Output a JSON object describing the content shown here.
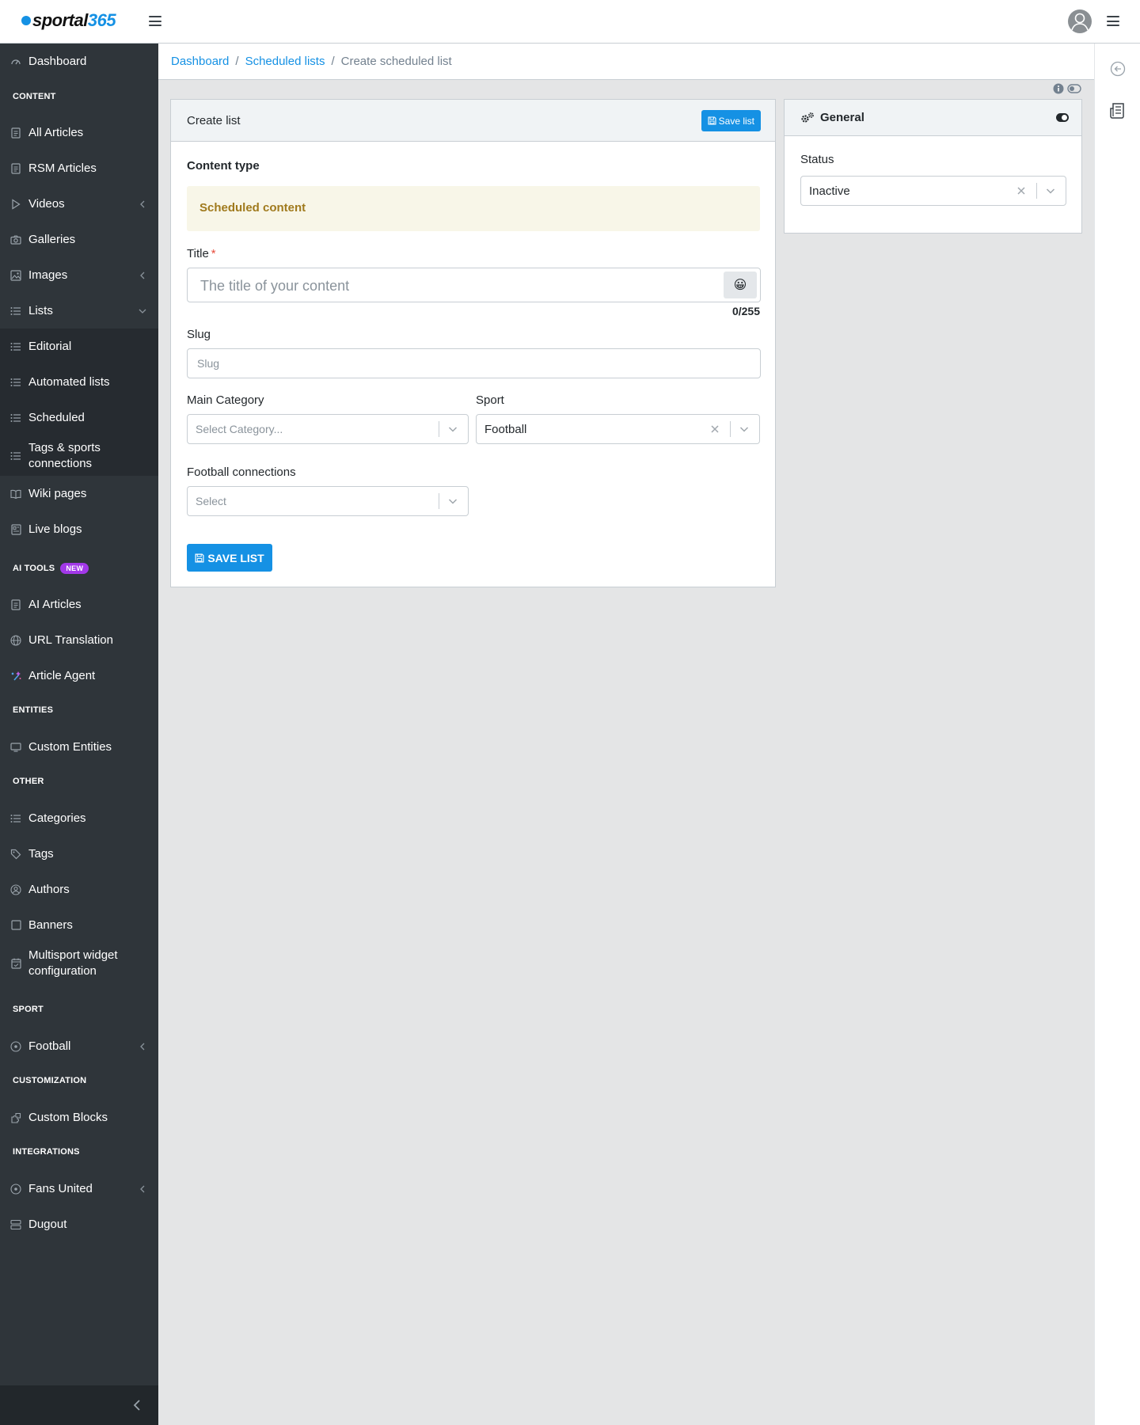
{
  "header": {
    "logo_text": "sportal",
    "logo_number": "365"
  },
  "sidebar": {
    "items": [
      {
        "label": "Dashboard"
      },
      {
        "label": "CONTENT"
      },
      {
        "label": "All Articles"
      },
      {
        "label": "RSM Articles"
      },
      {
        "label": "Videos"
      },
      {
        "label": "Galleries"
      },
      {
        "label": "Images"
      },
      {
        "label": "Lists"
      },
      {
        "label": "Editorial"
      },
      {
        "label": "Automated lists"
      },
      {
        "label": "Scheduled"
      },
      {
        "label": "Tags & sports connections"
      },
      {
        "label": "Wiki pages"
      },
      {
        "label": "Live blogs"
      },
      {
        "label": "AI TOOLS"
      },
      {
        "label": "AI Articles"
      },
      {
        "label": "URL Translation"
      },
      {
        "label": "Article Agent"
      },
      {
        "label": "ENTITIES"
      },
      {
        "label": "Custom Entities"
      },
      {
        "label": "OTHER"
      },
      {
        "label": "Categories"
      },
      {
        "label": "Tags"
      },
      {
        "label": "Authors"
      },
      {
        "label": "Banners"
      },
      {
        "label": "Multisport widget configuration"
      },
      {
        "label": "SPORT"
      },
      {
        "label": "Football"
      },
      {
        "label": "CUSTOMIZATION"
      },
      {
        "label": "Custom Blocks"
      },
      {
        "label": "INTEGRATIONS"
      },
      {
        "label": "Fans United"
      },
      {
        "label": "Dugout"
      }
    ],
    "ai_badge": "NEW"
  },
  "breadcrumb": {
    "items": [
      "Dashboard",
      "Scheduled lists",
      "Create scheduled list"
    ],
    "separator": "/"
  },
  "main_card": {
    "title": "Create list",
    "save_button": "Save list",
    "content_type_label": "Content type",
    "content_type_value": "Scheduled content",
    "title_label": "Title",
    "title_required": "*",
    "title_placeholder": "The title of your content",
    "title_emoji": "😀",
    "title_counter": "0/255",
    "slug_label": "Slug",
    "slug_placeholder": "Slug",
    "main_category_label": "Main Category",
    "main_category_placeholder": "Select Category...",
    "sport_label": "Sport",
    "sport_value": "Football",
    "football_connections_label": "Football connections",
    "football_connections_placeholder": "Select",
    "save_list_button": "SAVE LIST"
  },
  "side_card": {
    "title": "General",
    "status_label": "Status",
    "status_value": "Inactive"
  },
  "colors": {
    "accent": "#1591e4",
    "sidebar_bg": "#2f353a",
    "sidebar_sub_bg": "#262b30",
    "page_bg": "#e4e5e6",
    "alert_bg": "#f8f6e8",
    "alert_text": "#a07a1d",
    "badge_new": "#a238e8"
  }
}
